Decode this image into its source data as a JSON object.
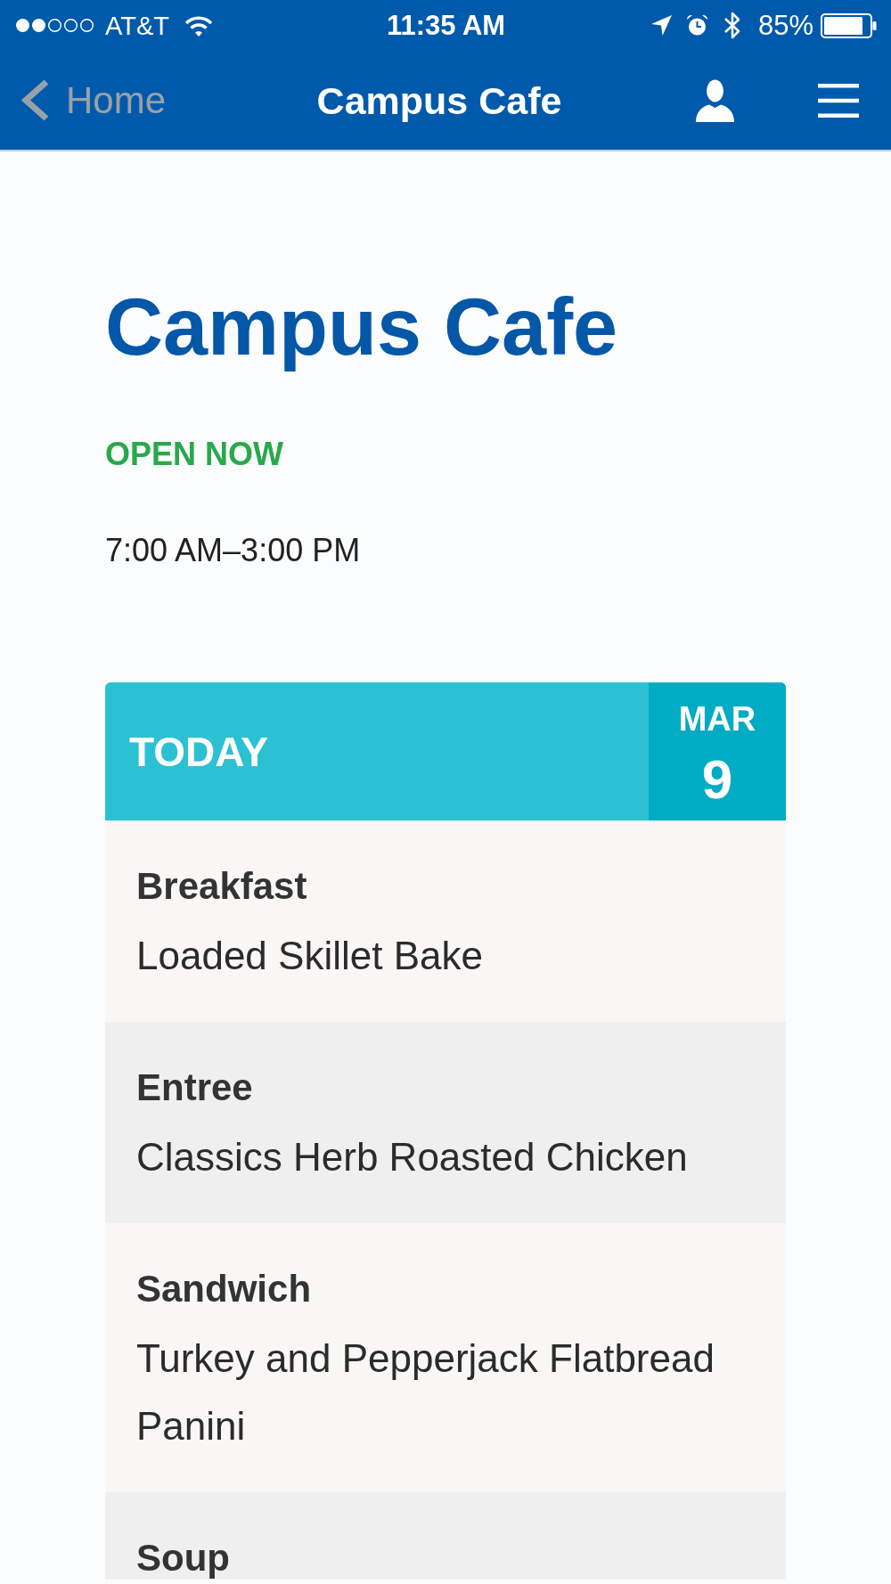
{
  "status_bar": {
    "carrier": "AT&T",
    "time": "11:35 AM",
    "battery": "85%"
  },
  "nav_bar": {
    "back": {
      "label": "Home",
      "disabled": true
    },
    "title": "Campus Cafe"
  },
  "cafe": {
    "name": "Campus Cafe",
    "status": {
      "label": "OPEN NOW",
      "open": true
    },
    "hours": "7:00 AM–3:00 PM"
  },
  "menu_card": {
    "day_label": "TODAY",
    "date": {
      "month": "MAR",
      "day": "9"
    },
    "items": [
      {
        "category": "Breakfast",
        "dish": "Loaded Skillet Bake"
      },
      {
        "category": "Entree",
        "dish": "Classics Herb Roasted Chicken"
      },
      {
        "category": "Sandwich",
        "dish": "Turkey and Pepperjack Flatbread Panini"
      },
      {
        "category": "Soup"
      }
    ]
  }
}
